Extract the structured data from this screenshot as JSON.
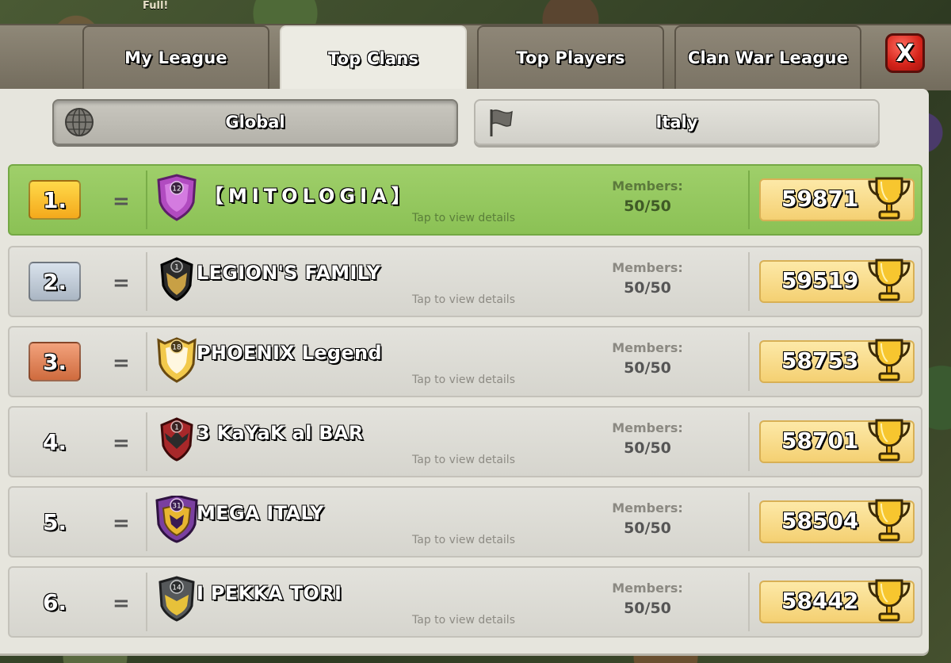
{
  "background": {
    "label": "Full!"
  },
  "tabs": [
    {
      "label": "My League",
      "active": false
    },
    {
      "label": "Top Clans",
      "active": true
    },
    {
      "label": "Top Players",
      "active": false
    },
    {
      "label": "Clan War League",
      "active": false
    }
  ],
  "close": {
    "label": "X"
  },
  "scope": {
    "global_label": "Global",
    "country_label": "Italy",
    "selected": "Global"
  },
  "rows_common": {
    "tap_hint": "Tap to view details",
    "members_label": "Members:",
    "rank_change": "="
  },
  "clans": [
    {
      "rank": "1.",
      "name": "【MITOLOGIA】",
      "level": "12",
      "members": "50/50",
      "trophies": "59871",
      "badge_color": "#b14bc0",
      "rank_style": "gold"
    },
    {
      "rank": "2.",
      "name": "LEGION'S FAMILY",
      "level": "1",
      "members": "50/50",
      "trophies": "59519",
      "badge_color": "#2a2a2a",
      "rank_style": "silver"
    },
    {
      "rank": "3.",
      "name": "PHOENIX Legend",
      "level": "18",
      "members": "50/50",
      "trophies": "58753",
      "badge_color": "#f2c94c",
      "rank_style": "bronze"
    },
    {
      "rank": "4.",
      "name": "3 KaYaK al BAR",
      "level": "1",
      "members": "50/50",
      "trophies": "58701",
      "badge_color": "#a8282a",
      "rank_style": "plain"
    },
    {
      "rank": "5.",
      "name": "MEGA ITALY",
      "level": "31",
      "members": "50/50",
      "trophies": "58504",
      "badge_color": "#7a3fa0",
      "rank_style": "plain"
    },
    {
      "rank": "6.",
      "name": "I PEKKA TORI",
      "level": "14",
      "members": "50/50",
      "trophies": "58442",
      "badge_color": "#e7c13a",
      "rank_style": "plain"
    }
  ],
  "colors": {
    "highlight_row": "#95c95f",
    "trophy_box": "#f7da86",
    "close_button": "#d4231a"
  }
}
